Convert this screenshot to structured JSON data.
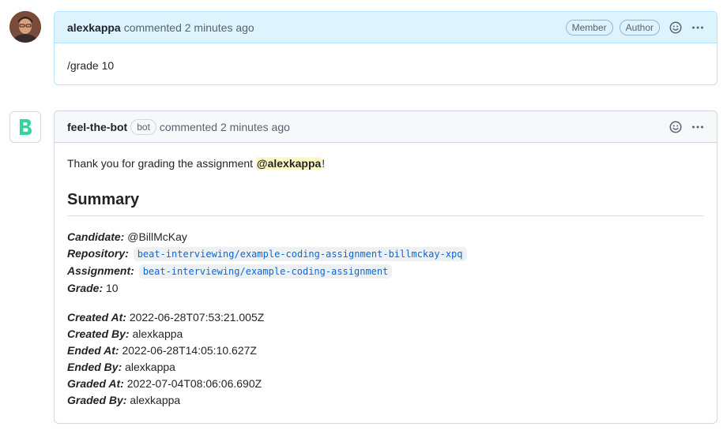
{
  "comments": [
    {
      "author": "alexkappa",
      "action": "commented 2 minutes ago",
      "badges": [
        "Member",
        "Author"
      ],
      "body": "/grade 10"
    },
    {
      "author": "feel-the-bot",
      "bot_label": "bot",
      "action": "commented 2 minutes ago",
      "intro_prefix": "Thank you for grading the assignment ",
      "mention": "@alexkappa",
      "intro_suffix": "!",
      "heading": "Summary",
      "fields": {
        "candidate_label": "Candidate:",
        "candidate_value": "@BillMcKay",
        "repository_label": "Repository:",
        "repository_value": "beat-interviewing/example-coding-assignment-billmckay-xpq",
        "assignment_label": "Assignment:",
        "assignment_value": "beat-interviewing/example-coding-assignment",
        "grade_label": "Grade:",
        "grade_value": "10",
        "created_at_label": "Created At:",
        "created_at_value": "2022-06-28T07:53:21.005Z",
        "created_by_label": "Created By:",
        "created_by_value": "alexkappa",
        "ended_at_label": "Ended At:",
        "ended_at_value": "2022-06-28T14:05:10.627Z",
        "ended_by_label": "Ended By:",
        "ended_by_value": "alexkappa",
        "graded_at_label": "Graded At:",
        "graded_at_value": "2022-07-04T08:06:06.690Z",
        "graded_by_label": "Graded By:",
        "graded_by_value": "alexkappa"
      }
    }
  ],
  "icons": {
    "reaction": "smiley-icon",
    "menu": "kebab-horizontal-icon",
    "bot_logo": "bot-b-logo-icon"
  },
  "colors": {
    "mention_highlight": "#fff8c5",
    "link": "#0969da",
    "bot_logo": "#2fd6a3"
  }
}
